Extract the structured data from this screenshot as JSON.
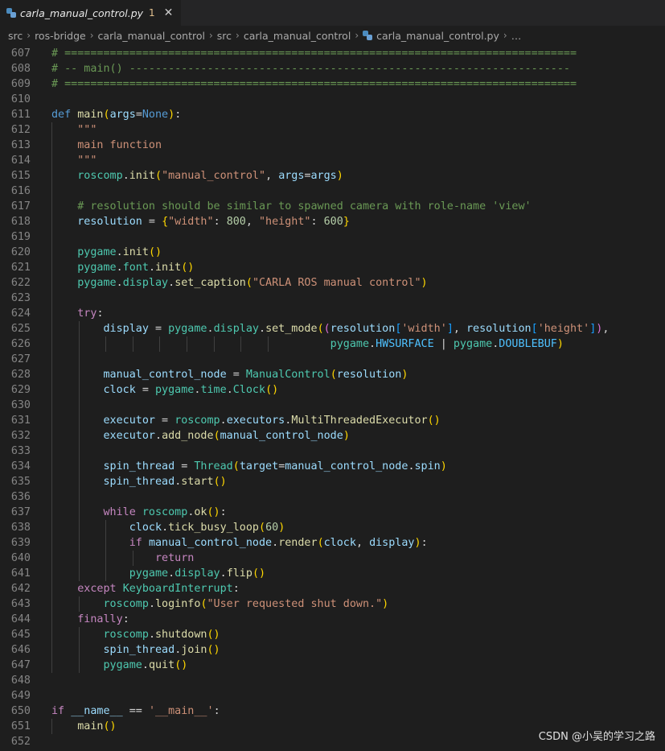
{
  "tab": {
    "label": "carla_manual_control.py",
    "badge": "1",
    "close": "✕"
  },
  "breadcrumb": {
    "items": [
      "src",
      "ros-bridge",
      "carla_manual_control",
      "src",
      "carla_manual_control"
    ],
    "file": "carla_manual_control.py",
    "more": "…",
    "separator": "›"
  },
  "watermark": "CSDN @小吴的学习之路",
  "colors": {
    "background": "#1e1e1e",
    "comment": "#6a9955",
    "keyword": "#569cd6",
    "control_keyword": "#c586c0",
    "function": "#dcdcaa",
    "variable": "#9cdcfe",
    "string": "#ce9178",
    "number": "#b5cea8",
    "class": "#4ec9b0"
  },
  "icons": {
    "file_type": "python-file-icon"
  },
  "lines": [
    {
      "n": "607",
      "tokens": [
        [
          "cm",
          "# ==============================================================================="
        ]
      ]
    },
    {
      "n": "608",
      "tokens": [
        [
          "cm",
          "# -- main() --------------------------------------------------------------------"
        ]
      ]
    },
    {
      "n": "609",
      "tokens": [
        [
          "cm",
          "# ==============================================================================="
        ]
      ]
    },
    {
      "n": "610",
      "tokens": []
    },
    {
      "n": "611",
      "tokens": [
        [
          "kw",
          "def"
        ],
        [
          "df",
          " "
        ],
        [
          "fn",
          "main"
        ],
        [
          "p1",
          "("
        ],
        [
          "vr",
          "args"
        ],
        [
          "df",
          "="
        ],
        [
          "kw",
          "None"
        ],
        [
          "p1",
          ")"
        ],
        [
          "df",
          ":"
        ]
      ]
    },
    {
      "n": "612",
      "tokens": [
        [
          "df",
          "    "
        ],
        [
          "st",
          "\"\"\""
        ]
      ]
    },
    {
      "n": "613",
      "tokens": [
        [
          "df",
          "    "
        ],
        [
          "st",
          "main function"
        ]
      ]
    },
    {
      "n": "614",
      "tokens": [
        [
          "df",
          "    "
        ],
        [
          "st",
          "\"\"\""
        ]
      ]
    },
    {
      "n": "615",
      "tokens": [
        [
          "df",
          "    "
        ],
        [
          "cl",
          "roscomp"
        ],
        [
          "df",
          "."
        ],
        [
          "fn",
          "init"
        ],
        [
          "p1",
          "("
        ],
        [
          "st",
          "\"manual_control\""
        ],
        [
          "df",
          ", "
        ],
        [
          "vr",
          "args"
        ],
        [
          "df",
          "="
        ],
        [
          "vr",
          "args"
        ],
        [
          "p1",
          ")"
        ]
      ]
    },
    {
      "n": "616",
      "tokens": []
    },
    {
      "n": "617",
      "tokens": [
        [
          "df",
          "    "
        ],
        [
          "cm",
          "# resolution should be similar to spawned camera with role-name 'view'"
        ]
      ]
    },
    {
      "n": "618",
      "tokens": [
        [
          "df",
          "    "
        ],
        [
          "vr",
          "resolution"
        ],
        [
          "df",
          " = "
        ],
        [
          "p1",
          "{"
        ],
        [
          "st",
          "\"width\""
        ],
        [
          "df",
          ": "
        ],
        [
          "nu",
          "800"
        ],
        [
          "df",
          ", "
        ],
        [
          "st",
          "\"height\""
        ],
        [
          "df",
          ": "
        ],
        [
          "nu",
          "600"
        ],
        [
          "p1",
          "}"
        ]
      ]
    },
    {
      "n": "619",
      "tokens": []
    },
    {
      "n": "620",
      "tokens": [
        [
          "df",
          "    "
        ],
        [
          "cl",
          "pygame"
        ],
        [
          "df",
          "."
        ],
        [
          "fn",
          "init"
        ],
        [
          "p1",
          "()"
        ]
      ]
    },
    {
      "n": "621",
      "tokens": [
        [
          "df",
          "    "
        ],
        [
          "cl",
          "pygame"
        ],
        [
          "df",
          "."
        ],
        [
          "cl",
          "font"
        ],
        [
          "df",
          "."
        ],
        [
          "fn",
          "init"
        ],
        [
          "p1",
          "()"
        ]
      ]
    },
    {
      "n": "622",
      "tokens": [
        [
          "df",
          "    "
        ],
        [
          "cl",
          "pygame"
        ],
        [
          "df",
          "."
        ],
        [
          "cl",
          "display"
        ],
        [
          "df",
          "."
        ],
        [
          "fn",
          "set_caption"
        ],
        [
          "p1",
          "("
        ],
        [
          "st",
          "\"CARLA ROS manual control\""
        ],
        [
          "p1",
          ")"
        ]
      ]
    },
    {
      "n": "623",
      "tokens": []
    },
    {
      "n": "624",
      "tokens": [
        [
          "df",
          "    "
        ],
        [
          "kw2",
          "try"
        ],
        [
          "df",
          ":"
        ]
      ]
    },
    {
      "n": "625",
      "tokens": [
        [
          "df",
          "        "
        ],
        [
          "vr",
          "display"
        ],
        [
          "df",
          " = "
        ],
        [
          "cl",
          "pygame"
        ],
        [
          "df",
          "."
        ],
        [
          "cl",
          "display"
        ],
        [
          "df",
          "."
        ],
        [
          "fn",
          "set_mode"
        ],
        [
          "p1",
          "("
        ],
        [
          "p2",
          "("
        ],
        [
          "vr",
          "resolution"
        ],
        [
          "p3",
          "["
        ],
        [
          "st",
          "'width'"
        ],
        [
          "p3",
          "]"
        ],
        [
          "df",
          ", "
        ],
        [
          "vr",
          "resolution"
        ],
        [
          "p3",
          "["
        ],
        [
          "st",
          "'height'"
        ],
        [
          "p3",
          "]"
        ],
        [
          "p2",
          ")"
        ],
        [
          "df",
          ","
        ]
      ]
    },
    {
      "n": "626",
      "tokens": [
        [
          "df",
          "                                           "
        ],
        [
          "cl",
          "pygame"
        ],
        [
          "df",
          "."
        ],
        [
          "cn",
          "HWSURFACE"
        ],
        [
          "df",
          " | "
        ],
        [
          "cl",
          "pygame"
        ],
        [
          "df",
          "."
        ],
        [
          "cn",
          "DOUBLEBUF"
        ],
        [
          "p1",
          ")"
        ]
      ]
    },
    {
      "n": "627",
      "tokens": []
    },
    {
      "n": "628",
      "tokens": [
        [
          "df",
          "        "
        ],
        [
          "vr",
          "manual_control_node"
        ],
        [
          "df",
          " = "
        ],
        [
          "cl",
          "ManualControl"
        ],
        [
          "p1",
          "("
        ],
        [
          "vr",
          "resolution"
        ],
        [
          "p1",
          ")"
        ]
      ]
    },
    {
      "n": "629",
      "tokens": [
        [
          "df",
          "        "
        ],
        [
          "vr",
          "clock"
        ],
        [
          "df",
          " = "
        ],
        [
          "cl",
          "pygame"
        ],
        [
          "df",
          "."
        ],
        [
          "cl",
          "time"
        ],
        [
          "df",
          "."
        ],
        [
          "cl",
          "Clock"
        ],
        [
          "p1",
          "()"
        ]
      ]
    },
    {
      "n": "630",
      "tokens": []
    },
    {
      "n": "631",
      "tokens": [
        [
          "df",
          "        "
        ],
        [
          "vr",
          "executor"
        ],
        [
          "df",
          " = "
        ],
        [
          "cl",
          "roscomp"
        ],
        [
          "df",
          "."
        ],
        [
          "vr",
          "executors"
        ],
        [
          "df",
          "."
        ],
        [
          "fn",
          "MultiThreadedExecutor"
        ],
        [
          "p1",
          "()"
        ]
      ]
    },
    {
      "n": "632",
      "tokens": [
        [
          "df",
          "        "
        ],
        [
          "vr",
          "executor"
        ],
        [
          "df",
          "."
        ],
        [
          "fn",
          "add_node"
        ],
        [
          "p1",
          "("
        ],
        [
          "vr",
          "manual_control_node"
        ],
        [
          "p1",
          ")"
        ]
      ]
    },
    {
      "n": "633",
      "tokens": []
    },
    {
      "n": "634",
      "tokens": [
        [
          "df",
          "        "
        ],
        [
          "vr",
          "spin_thread"
        ],
        [
          "df",
          " = "
        ],
        [
          "cl",
          "Thread"
        ],
        [
          "p1",
          "("
        ],
        [
          "vr",
          "target"
        ],
        [
          "df",
          "="
        ],
        [
          "vr",
          "manual_control_node"
        ],
        [
          "df",
          "."
        ],
        [
          "vr",
          "spin"
        ],
        [
          "p1",
          ")"
        ]
      ]
    },
    {
      "n": "635",
      "tokens": [
        [
          "df",
          "        "
        ],
        [
          "vr",
          "spin_thread"
        ],
        [
          "df",
          "."
        ],
        [
          "fn",
          "start"
        ],
        [
          "p1",
          "()"
        ]
      ]
    },
    {
      "n": "636",
      "tokens": []
    },
    {
      "n": "637",
      "tokens": [
        [
          "df",
          "        "
        ],
        [
          "kw2",
          "while"
        ],
        [
          "df",
          " "
        ],
        [
          "cl",
          "roscomp"
        ],
        [
          "df",
          "."
        ],
        [
          "fn",
          "ok"
        ],
        [
          "p1",
          "()"
        ],
        [
          "df",
          ":"
        ]
      ]
    },
    {
      "n": "638",
      "tokens": [
        [
          "df",
          "            "
        ],
        [
          "vr",
          "clock"
        ],
        [
          "df",
          "."
        ],
        [
          "fn",
          "tick_busy_loop"
        ],
        [
          "p1",
          "("
        ],
        [
          "nu",
          "60"
        ],
        [
          "p1",
          ")"
        ]
      ]
    },
    {
      "n": "639",
      "tokens": [
        [
          "df",
          "            "
        ],
        [
          "kw2",
          "if"
        ],
        [
          "df",
          " "
        ],
        [
          "vr",
          "manual_control_node"
        ],
        [
          "df",
          "."
        ],
        [
          "fn",
          "render"
        ],
        [
          "p1",
          "("
        ],
        [
          "vr",
          "clock"
        ],
        [
          "df",
          ", "
        ],
        [
          "vr",
          "display"
        ],
        [
          "p1",
          ")"
        ],
        [
          "df",
          ":"
        ]
      ]
    },
    {
      "n": "640",
      "tokens": [
        [
          "df",
          "                "
        ],
        [
          "kw2",
          "return"
        ]
      ]
    },
    {
      "n": "641",
      "tokens": [
        [
          "df",
          "            "
        ],
        [
          "cl",
          "pygame"
        ],
        [
          "df",
          "."
        ],
        [
          "cl",
          "display"
        ],
        [
          "df",
          "."
        ],
        [
          "fn",
          "flip"
        ],
        [
          "p1",
          "()"
        ]
      ]
    },
    {
      "n": "642",
      "tokens": [
        [
          "df",
          "    "
        ],
        [
          "kw2",
          "except"
        ],
        [
          "df",
          " "
        ],
        [
          "cl",
          "KeyboardInterrupt"
        ],
        [
          "df",
          ":"
        ]
      ]
    },
    {
      "n": "643",
      "tokens": [
        [
          "df",
          "        "
        ],
        [
          "cl",
          "roscomp"
        ],
        [
          "df",
          "."
        ],
        [
          "fn",
          "loginfo"
        ],
        [
          "p1",
          "("
        ],
        [
          "st",
          "\"User requested shut down.\""
        ],
        [
          "p1",
          ")"
        ]
      ]
    },
    {
      "n": "644",
      "tokens": [
        [
          "df",
          "    "
        ],
        [
          "kw2",
          "finally"
        ],
        [
          "df",
          ":"
        ]
      ]
    },
    {
      "n": "645",
      "tokens": [
        [
          "df",
          "        "
        ],
        [
          "cl",
          "roscomp"
        ],
        [
          "df",
          "."
        ],
        [
          "fn",
          "shutdown"
        ],
        [
          "p1",
          "()"
        ]
      ]
    },
    {
      "n": "646",
      "tokens": [
        [
          "df",
          "        "
        ],
        [
          "vr",
          "spin_thread"
        ],
        [
          "df",
          "."
        ],
        [
          "fn",
          "join"
        ],
        [
          "p1",
          "()"
        ]
      ]
    },
    {
      "n": "647",
      "tokens": [
        [
          "df",
          "        "
        ],
        [
          "cl",
          "pygame"
        ],
        [
          "df",
          "."
        ],
        [
          "fn",
          "quit"
        ],
        [
          "p1",
          "()"
        ]
      ]
    },
    {
      "n": "648",
      "tokens": []
    },
    {
      "n": "649",
      "tokens": []
    },
    {
      "n": "650",
      "tokens": [
        [
          "kw2",
          "if"
        ],
        [
          "df",
          " "
        ],
        [
          "vr",
          "__name__"
        ],
        [
          "df",
          " == "
        ],
        [
          "st",
          "'__main__'"
        ],
        [
          "df",
          ":"
        ]
      ]
    },
    {
      "n": "651",
      "tokens": [
        [
          "df",
          "    "
        ],
        [
          "fn",
          "main"
        ],
        [
          "p1",
          "()"
        ]
      ]
    },
    {
      "n": "652",
      "tokens": []
    }
  ]
}
